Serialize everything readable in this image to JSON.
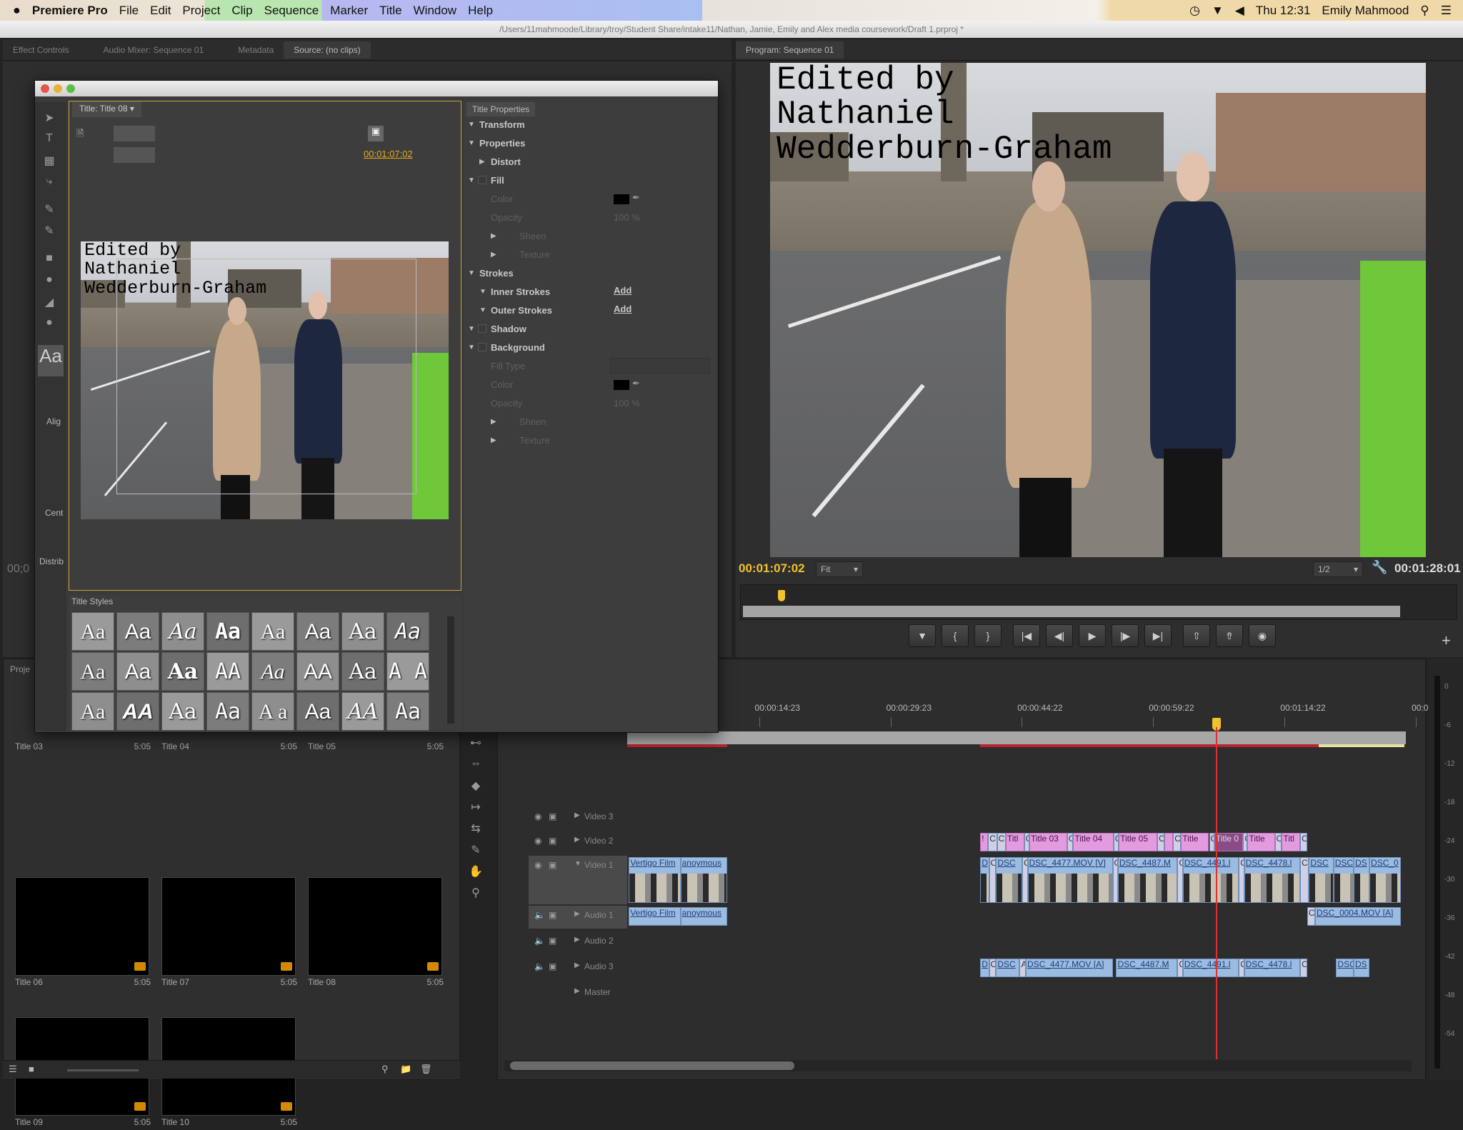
{
  "menubar": {
    "app": "Premiere Pro",
    "items": [
      "File",
      "Edit",
      "Project",
      "Clip",
      "Sequence",
      "Marker",
      "Title",
      "Window",
      "Help"
    ],
    "clock": "Thu 12:31",
    "user": "Emily Mahmood"
  },
  "window": {
    "path": "/Users/11mahmoode/Library/troy/Student Share/intake11/Nathan, Jamie, Emily and Alex media coursework/Draft 1.prproj *"
  },
  "top_tabs": {
    "left": [
      "Effect Controls",
      "Audio Mixer: Sequence 01",
      "Metadata",
      "Source: (no clips)"
    ],
    "program": "Program: Sequence 01"
  },
  "title_window": {
    "tab": "Title: Title 08",
    "timecode": "00:01:07:02",
    "overlay_text": "Edited by\nNathaniel\nWedderburn-Graham",
    "styles_tab": "Title Styles",
    "align_label": "Alig",
    "center_label": "Cent",
    "distribute_label": "Distrib",
    "style_samples": [
      "Aa",
      "Aa",
      "Aa",
      "Aa",
      "Aa",
      "Aa",
      "Aa",
      "Aa",
      "Aa",
      "Aa",
      "Aa",
      "AA",
      "Aa",
      "AA",
      "Aa",
      "A A",
      "Aa",
      "AA",
      "Aa",
      "Aa",
      "A a",
      "Aa",
      "AA",
      "Aa"
    ]
  },
  "title_properties": {
    "tab": "Title Properties",
    "rows": [
      {
        "label": "Transform",
        "level": 0,
        "state": "open",
        "dim": false
      },
      {
        "label": "Properties",
        "level": 0,
        "state": "open",
        "dim": false
      },
      {
        "label": "Distort",
        "level": 1,
        "state": "closed",
        "dim": false
      },
      {
        "label": "Fill",
        "level": 0,
        "state": "open",
        "dim": false,
        "check": true
      },
      {
        "label": "Color",
        "level": 1,
        "dim": true,
        "swatch": "#000000"
      },
      {
        "label": "Opacity",
        "level": 1,
        "dim": true,
        "value": "100 %"
      },
      {
        "label": "Sheen",
        "level": 2,
        "state": "closed",
        "dim": true
      },
      {
        "label": "Texture",
        "level": 2,
        "state": "closed",
        "dim": true
      },
      {
        "label": "Strokes",
        "level": 0,
        "state": "open",
        "dim": false
      },
      {
        "label": "Inner Strokes",
        "level": 1,
        "state": "open",
        "dim": false,
        "action": "Add"
      },
      {
        "label": "Outer Strokes",
        "level": 1,
        "state": "open",
        "dim": false,
        "action": "Add"
      },
      {
        "label": "Shadow",
        "level": 0,
        "state": "open",
        "dim": false,
        "check": true
      },
      {
        "label": "Background",
        "level": 0,
        "state": "open",
        "dim": false,
        "check": true
      },
      {
        "label": "Fill Type",
        "level": 1,
        "dim": true,
        "dropdown": true
      },
      {
        "label": "Color",
        "level": 1,
        "dim": true,
        "swatch": "#000000"
      },
      {
        "label": "Opacity",
        "level": 1,
        "dim": true,
        "value": "100 %"
      },
      {
        "label": "Sheen",
        "level": 2,
        "state": "closed",
        "dim": true
      },
      {
        "label": "Texture",
        "level": 2,
        "state": "closed",
        "dim": true
      }
    ]
  },
  "program": {
    "timecode": "00:01:07:02",
    "zoom": "Fit",
    "resolution": "1/2",
    "duration": "00:01:28:01",
    "overlay_text": "Edited by\nNathaniel\nWedderburn-Graham",
    "playhead_fraction": 0.057,
    "controls": [
      "marker",
      "mark-in",
      "mark-out",
      "go-to-in",
      "step-back",
      "play",
      "step-forward",
      "go-to-out",
      "lift",
      "extract",
      "export-frame"
    ]
  },
  "project": {
    "tab": "Proje",
    "source_timecode": "00;0",
    "items": [
      {
        "name": "Title 03",
        "duration": "5:05",
        "visible_thumb": false
      },
      {
        "name": "Title 04",
        "duration": "5:05",
        "visible_thumb": false
      },
      {
        "name": "Title 05",
        "duration": "5:05",
        "visible_thumb": false
      },
      {
        "name": "Title 06",
        "duration": "5:05",
        "visible_thumb": true
      },
      {
        "name": "Title 07",
        "duration": "5:05",
        "visible_thumb": true
      },
      {
        "name": "Title 08",
        "duration": "5:05",
        "visible_thumb": true
      },
      {
        "name": "Title 09",
        "duration": "5:05",
        "visible_thumb": true
      },
      {
        "name": "Title 10",
        "duration": "5:05",
        "visible_thumb": true
      }
    ]
  },
  "timeline": {
    "ruler": [
      {
        "t": 14.96,
        "label": "00:00:14:23"
      },
      {
        "t": 29.96,
        "label": "00:00:29:23"
      },
      {
        "t": 44.92,
        "label": "00:00:44:22"
      },
      {
        "t": 59.92,
        "label": "00:00:59:22"
      },
      {
        "t": 74.92,
        "label": "00:01:14:22"
      },
      {
        "t": 89.9,
        "label": "00:0"
      }
    ],
    "playhead_seconds": 67.07,
    "tracks": [
      "Video 3",
      "Video 2",
      "Video 1",
      "Audio 1",
      "Audio 2",
      "Audio 3",
      "Master"
    ],
    "clips": {
      "Video 2": [
        [
          "!",
          40.2,
          41.1,
          "title"
        ],
        [
          "C",
          41.1,
          42.1,
          "trans"
        ],
        [
          "C",
          42.1,
          43.1,
          "trans"
        ],
        [
          "Titl",
          43.1,
          45.2,
          "title"
        ],
        [
          "C",
          45.2,
          45.8,
          "trans"
        ],
        [
          "Title 03",
          45.8,
          50.1,
          "title"
        ],
        [
          "C",
          50.1,
          50.8,
          "trans"
        ],
        [
          "Title 04",
          50.8,
          55.4,
          "title"
        ],
        [
          "C",
          55.4,
          56.0,
          "trans"
        ],
        [
          "Title 05",
          56.0,
          60.4,
          "title"
        ],
        [
          "C",
          60.4,
          61.2,
          "trans"
        ],
        [
          "",
          61.2,
          62.2,
          "title"
        ],
        [
          "C",
          62.2,
          63.1,
          "trans"
        ],
        [
          "Title",
          63.1,
          66.3,
          "title"
        ],
        [
          "C",
          66.3,
          66.9,
          "trans"
        ],
        [
          "Title 0",
          66.9,
          70.2,
          "sel"
        ],
        [
          "C",
          70.2,
          70.7,
          "trans"
        ],
        [
          "Title",
          70.7,
          73.8,
          "title"
        ],
        [
          "C",
          73.8,
          74.6,
          "trans"
        ],
        [
          "Titl",
          74.6,
          76.7,
          "title"
        ],
        [
          "C",
          76.7,
          77.5,
          "trans"
        ]
      ],
      "Video 1": [
        [
          "Vertigo Film",
          0.1,
          6.0,
          "v"
        ],
        [
          "anoymous",
          6.0,
          11.3,
          "v"
        ],
        [
          "D",
          40.2,
          41.2,
          "v"
        ],
        [
          "C",
          41.2,
          42.0,
          "trans"
        ],
        [
          "DSC",
          42.0,
          45.0,
          "v"
        ],
        [
          "C",
          45.0,
          45.6,
          "trans"
        ],
        [
          "DSC_4477.MOV [V]",
          45.6,
          55.3,
          "v"
        ],
        [
          "C",
          55.3,
          55.9,
          "trans"
        ],
        [
          "DSC_4487.M",
          55.9,
          62.7,
          "v"
        ],
        [
          "C",
          62.7,
          63.3,
          "trans"
        ],
        [
          "DSC_4491.l",
          63.3,
          69.7,
          "v"
        ],
        [
          "C",
          69.7,
          70.3,
          "trans"
        ],
        [
          "DSC_4478.l",
          70.3,
          76.7,
          "v"
        ],
        [
          "C",
          76.7,
          77.7,
          "trans"
        ],
        [
          "DSC",
          77.7,
          80.5,
          "v"
        ],
        [
          "DSC",
          80.5,
          82.8,
          "v"
        ],
        [
          "DS",
          82.8,
          84.6,
          "v"
        ],
        [
          "DSC_0",
          84.6,
          88.2,
          "v"
        ]
      ],
      "Audio 1": [
        [
          "Vertigo Film",
          0.1,
          6.0,
          "a"
        ],
        [
          "anoymous",
          6.0,
          11.3,
          "a"
        ],
        [
          "C",
          77.5,
          78.4,
          "trans"
        ],
        [
          "DSC_0004.MOV [A]",
          78.4,
          88.2,
          "a"
        ]
      ],
      "Audio 3": [
        [
          "D",
          40.2,
          41.2,
          "a"
        ],
        [
          "C",
          41.2,
          42.0,
          "trans"
        ],
        [
          "DSC",
          42.0,
          44.7,
          "a"
        ],
        [
          "A",
          44.7,
          45.4,
          "trans"
        ],
        [
          "DSC_4477.MOV [A]",
          45.4,
          55.3,
          "a"
        ],
        [
          "DSC_4487.M",
          55.7,
          62.7,
          "a"
        ],
        [
          "C",
          62.7,
          63.3,
          "trans"
        ],
        [
          "DSC_4491.l",
          63.3,
          69.7,
          "a"
        ],
        [
          "C",
          69.7,
          70.3,
          "trans"
        ],
        [
          "DSC_4478.l",
          70.3,
          76.7,
          "a"
        ],
        [
          "C",
          76.7,
          77.5,
          "trans"
        ],
        [
          "DSC",
          80.8,
          82.8,
          "a"
        ],
        [
          "DS",
          82.8,
          84.6,
          "a"
        ]
      ]
    }
  },
  "meter": {
    "ticks": [
      "0",
      "-6",
      "-12",
      "-18",
      "-24",
      "-30",
      "-36",
      "-42",
      "-48",
      "-54"
    ]
  }
}
